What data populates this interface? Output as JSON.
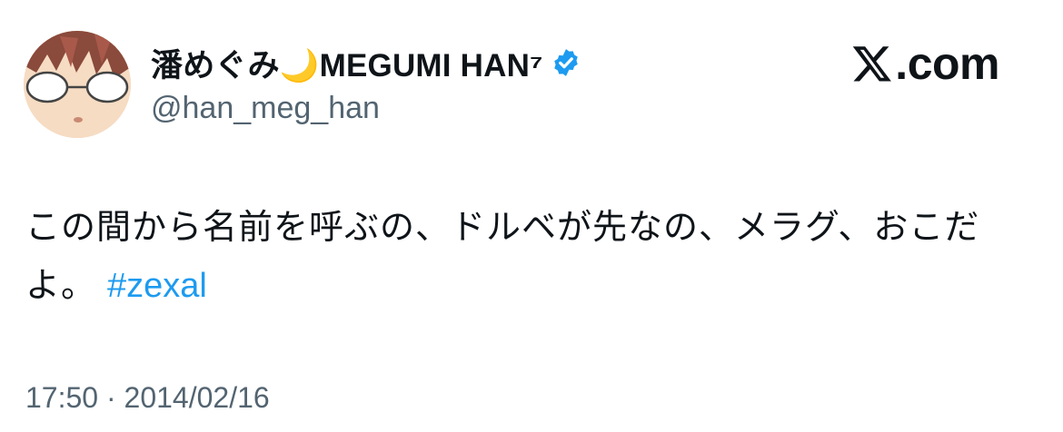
{
  "author": {
    "display_name": "潘めぐみ🌙MEGUMI HAN⁷",
    "handle": "@han_meg_han",
    "verified": true
  },
  "brand": {
    "site_label": ".com",
    "logo_icon": "x-logo-icon"
  },
  "tweet": {
    "text": "この間から名前を呼ぶの、ドルベが先なの、メラグ、おこだよ。",
    "hashtag": "#zexal",
    "timestamp": "17:50 · 2014/02/16"
  },
  "colors": {
    "text": "#0f1419",
    "secondary": "#536471",
    "link": "#1d9bf0",
    "verified": "#1d9bf0",
    "background": "#ffffff"
  }
}
